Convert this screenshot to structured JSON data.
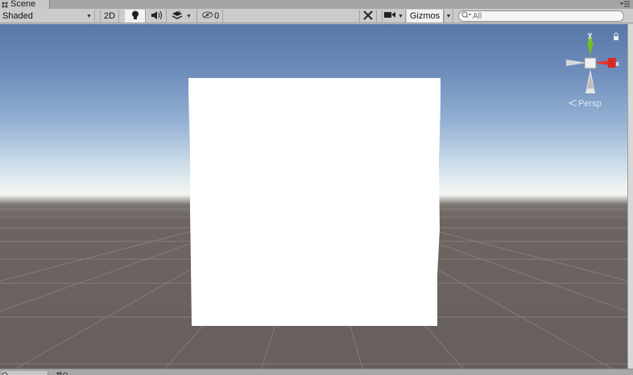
{
  "window": {
    "tab_label": "Scene"
  },
  "toolbar": {
    "shading_mode": "Shaded",
    "mode_2d": "2D",
    "hidden_count": "0",
    "gizmos_label": "Gizmos",
    "search_placeholder": "All"
  },
  "viewport": {
    "projection_label": "Persp",
    "axis_x": "x",
    "axis_y": "y",
    "colors": {
      "sky_top": "#5a7aa8",
      "horizon": "#f4f7f4",
      "ground": "#6b6460",
      "grid": "#8a837e",
      "cube": "#ffffff",
      "axis_x": "#e8332b",
      "axis_y": "#86d12b"
    }
  },
  "icons": [
    "scene-tab-icon",
    "tab-menu-icon",
    "lightbulb-icon",
    "audio-icon",
    "effects-icon",
    "hidden-eye-icon",
    "tools-icon",
    "camera-icon",
    "search-icon",
    "lock-icon",
    "persp-icon"
  ],
  "bottom_tabs": [
    "",
    ""
  ]
}
